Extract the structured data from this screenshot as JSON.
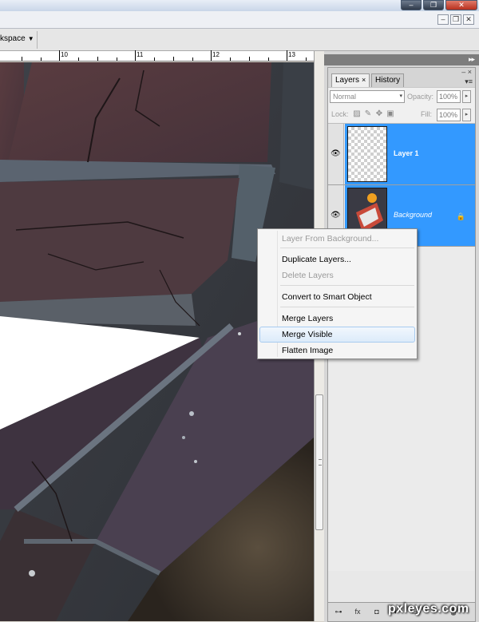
{
  "window": {
    "min_glyph": "‒",
    "restore_glyph": "❐",
    "close_glyph": "✕"
  },
  "document": {
    "min_glyph": "‒",
    "restore_glyph": "❐",
    "close_glyph": "✕"
  },
  "options_bar": {
    "workspace_label": "kspace",
    "workspace_arrow": "▼"
  },
  "ruler": {
    "labels": [
      "10",
      "11",
      "12",
      "13"
    ]
  },
  "dock": {
    "collapse_glyph": "▸▸"
  },
  "layers_panel": {
    "tabs": [
      {
        "label": "Layers",
        "close": "×",
        "active": true
      },
      {
        "label": "History",
        "active": false
      }
    ],
    "header_controls": "‒ ×",
    "menu_glyph": "▾≡",
    "blend_mode": "Normal",
    "opacity_label": "Opacity:",
    "opacity_value": "100%",
    "lock_label": "Lock:",
    "fill_label": "Fill:",
    "fill_value": "100%",
    "spin_glyph": "▸",
    "dropdown_glyph": "▾",
    "layers": [
      {
        "name": "Layer 1",
        "visible": true,
        "selected": true,
        "italic": false,
        "locked": false
      },
      {
        "name": "Background",
        "visible": true,
        "selected": true,
        "italic": true,
        "locked": true
      }
    ],
    "eye_glyph": "👁",
    "lock_glyph": "🔒",
    "footer_icons": [
      "link-icon",
      "fx-icon",
      "mask-icon",
      "adjustment-icon",
      "folder-icon",
      "new-layer-icon",
      "trash-icon"
    ],
    "footer_labels": [
      "⊶",
      "fx",
      "◘",
      "◐",
      "▭",
      "▫",
      "🗑"
    ]
  },
  "context_menu": {
    "items": [
      {
        "label": "Layer From Background...",
        "disabled": true
      },
      {
        "label": "Duplicate Layers...",
        "disabled": false
      },
      {
        "label": "Delete Layers",
        "disabled": true
      },
      {
        "label": "Convert to Smart Object",
        "disabled": false
      },
      {
        "label": "Merge Layers",
        "disabled": false
      },
      {
        "label": "Merge Visible",
        "disabled": false,
        "hover": true
      },
      {
        "label": "Flatten Image",
        "disabled": false
      }
    ]
  },
  "watermark": "pxleyes.com"
}
